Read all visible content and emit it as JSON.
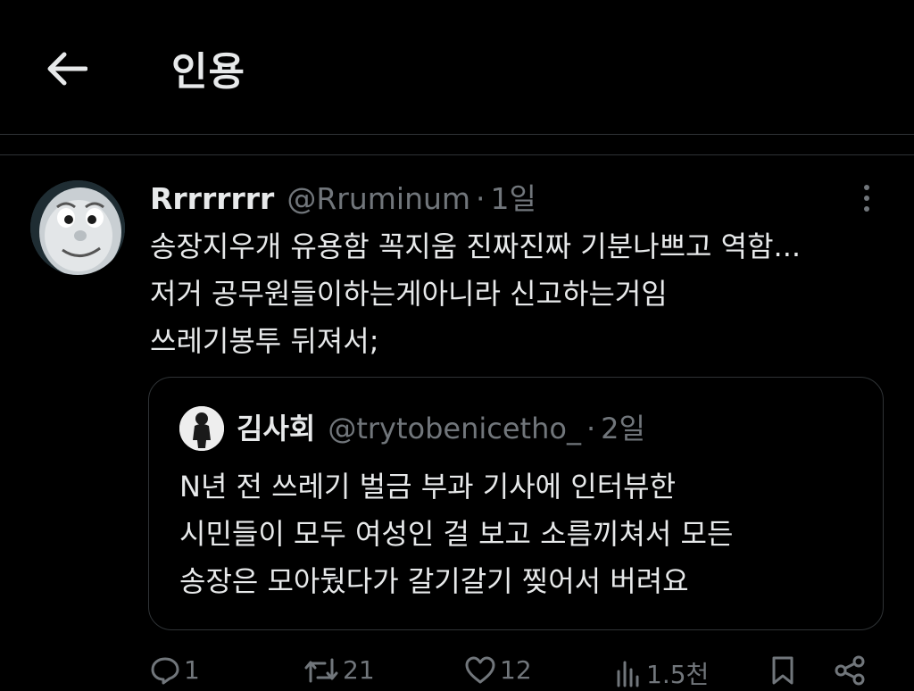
{
  "header": {
    "title": "인용"
  },
  "tweet": {
    "display_name": "Rrrrrrrr",
    "handle": "@Rruminum",
    "separator": "·",
    "time": "1일",
    "lines": [
      "송장지우개 유용함 꼭지움 진짜진짜 기분나쁘고 역함...",
      "저거 공무원들이하는게아니라 신고하는거임",
      "쓰레기봉투 뒤져서;"
    ]
  },
  "quote": {
    "display_name": "김사회",
    "handle": "@trytobenicetho_",
    "separator": "·",
    "time": "2일",
    "lines": [
      "N년 전 쓰레기 벌금 부과 기사에 인터뷰한",
      "시민들이 모두 여성인 걸 보고 소름끼쳐서 모든",
      "송장은 모아뒀다가 갈기갈기 찢어서 버려요"
    ]
  },
  "actions": {
    "replies": "1",
    "reposts": "21",
    "likes": "12",
    "views": "1.5천"
  },
  "icons": {
    "back": "arrow-left-icon",
    "more": "more-vertical-icon",
    "reply": "reply-icon",
    "repost": "repost-icon",
    "like": "heart-icon",
    "views": "views-icon",
    "bookmark": "bookmark-icon",
    "share": "share-icon"
  },
  "colors": {
    "background": "#000000",
    "text": "#e7e9ea",
    "muted": "#71767b",
    "border": "#2f3336"
  }
}
